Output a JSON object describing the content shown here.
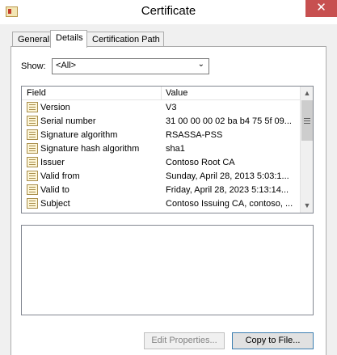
{
  "window": {
    "title": "Certificate",
    "close_glyph": "✕"
  },
  "tabs": [
    {
      "label": "General",
      "active": false
    },
    {
      "label": "Details",
      "active": true
    },
    {
      "label": "Certification Path",
      "active": false
    }
  ],
  "show": {
    "label": "Show:",
    "selected": "<All>"
  },
  "list": {
    "columns": [
      "Field",
      "Value"
    ],
    "rows": [
      {
        "field": "Version",
        "value": "V3"
      },
      {
        "field": "Serial number",
        "value": "31 00 00 00 02 ba b4 75 5f 09..."
      },
      {
        "field": "Signature algorithm",
        "value": "RSASSA-PSS"
      },
      {
        "field": "Signature hash algorithm",
        "value": "sha1"
      },
      {
        "field": "Issuer",
        "value": "Contoso Root CA"
      },
      {
        "field": "Valid from",
        "value": "Sunday, April 28, 2013 5:03:1..."
      },
      {
        "field": "Valid to",
        "value": "Friday, April 28, 2023 5:13:14..."
      },
      {
        "field": "Subject",
        "value": "Contoso Issuing CA, contoso, ..."
      }
    ]
  },
  "buttons": {
    "edit_properties": "Edit Properties...",
    "copy_to_file": "Copy to File..."
  },
  "colors": {
    "close_button": "#c75050",
    "window_bg": "#f0f0f0"
  },
  "icons": {
    "title": "certificate-icon",
    "field": "certificate-field-icon"
  }
}
